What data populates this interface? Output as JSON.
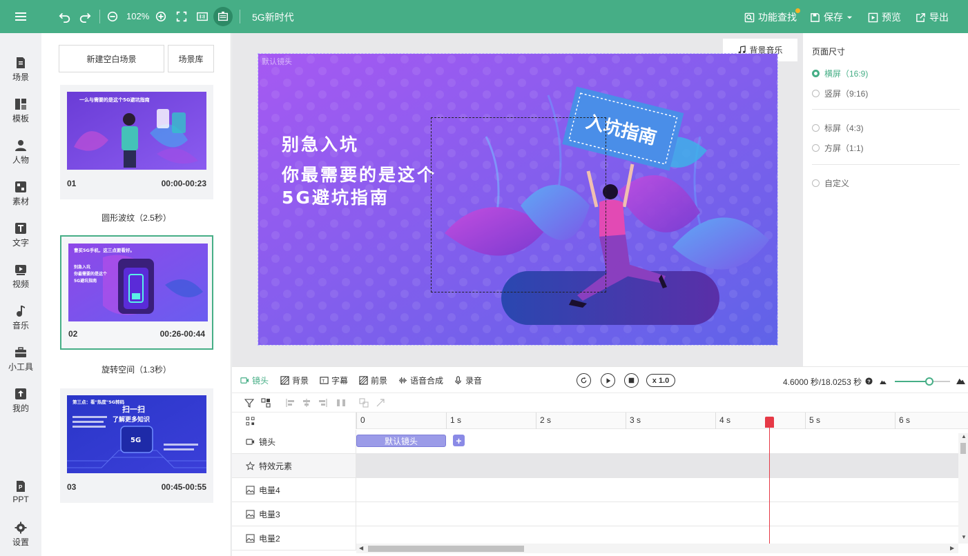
{
  "topbar": {
    "zoom": "102%",
    "doc_title": "5G新时代",
    "feature_search": "功能查找",
    "save": "保存",
    "preview": "预览",
    "export": "导出"
  },
  "nav": [
    {
      "label": "场景",
      "icon": "scene-icon"
    },
    {
      "label": "模板",
      "icon": "template-icon"
    },
    {
      "label": "人物",
      "icon": "person-icon"
    },
    {
      "label": "素材",
      "icon": "material-icon"
    },
    {
      "label": "文字",
      "icon": "text-icon"
    },
    {
      "label": "视频",
      "icon": "video-icon"
    },
    {
      "label": "音乐",
      "icon": "music-icon"
    },
    {
      "label": "小工具",
      "icon": "toolbox-icon"
    },
    {
      "label": "我的",
      "icon": "upload-icon"
    },
    {
      "label": "PPT",
      "icon": "ppt-icon"
    },
    {
      "label": "设置",
      "icon": "gear-icon"
    }
  ],
  "scenes_panel": {
    "new_blank": "新建空白场景",
    "library": "场景库",
    "scenes": [
      {
        "num": "01",
        "time": "00:00-00:23",
        "transition": "圆形波纹（2.5秒）"
      },
      {
        "num": "02",
        "time": "00:26-00:44",
        "transition": "旋转空间（1.3秒）"
      },
      {
        "num": "03",
        "time": "00:45-00:55"
      }
    ],
    "thumb1": {
      "title": "一么与需要的是这个5G避坑指南"
    },
    "thumb2": {
      "title": "曹买5G手机，这三点要看好。",
      "line1": "别急入坑",
      "line2": "你最需要的是这个",
      "line3": "5G避坑指南"
    },
    "thumb3": {
      "title": "第三点：看\"热度\"5G转码",
      "big": "扫一扫",
      "sub": "了解更多知识",
      "chip": "5G"
    }
  },
  "canvas": {
    "bgm": "背景音乐",
    "stage_label": "默认镜头",
    "line1": "别急入坑",
    "line2": "你最需要的是这个",
    "line3": "5G避坑指南",
    "sign": "入坑指南",
    "colors": {
      "bg_start": "#a659f2",
      "bg_end": "#5f63e8"
    }
  },
  "props": {
    "title": "页面尺寸",
    "options": [
      {
        "label": "横屏（16:9)",
        "selected": true
      },
      {
        "label": "竖屏（9:16)",
        "selected": false
      },
      {
        "label": "标屏（4:3)",
        "selected": false
      },
      {
        "label": "方屏（1:1)",
        "selected": false
      },
      {
        "label": "自定义",
        "selected": false
      }
    ]
  },
  "timeline": {
    "tabs": [
      "镜头",
      "背景",
      "字幕",
      "前景",
      "语音合成",
      "录音"
    ],
    "speed": "x 1.0",
    "time": "4.6000 秒/18.0253 秒",
    "zoom_fraction": 0.62,
    "ticks": [
      "0",
      "1 s",
      "2 s",
      "3 s",
      "4 s",
      "5 s",
      "6 s"
    ],
    "tracks": [
      {
        "label": "镜头",
        "icon": "camera-icon"
      },
      {
        "label": "特效元素",
        "icon": "star-icon"
      },
      {
        "label": "电量4",
        "icon": "image-icon"
      },
      {
        "label": "电量3",
        "icon": "image-icon"
      },
      {
        "label": "电量2",
        "icon": "image-icon"
      }
    ],
    "clip": "默认镜头",
    "playhead_seconds": 4.6
  }
}
